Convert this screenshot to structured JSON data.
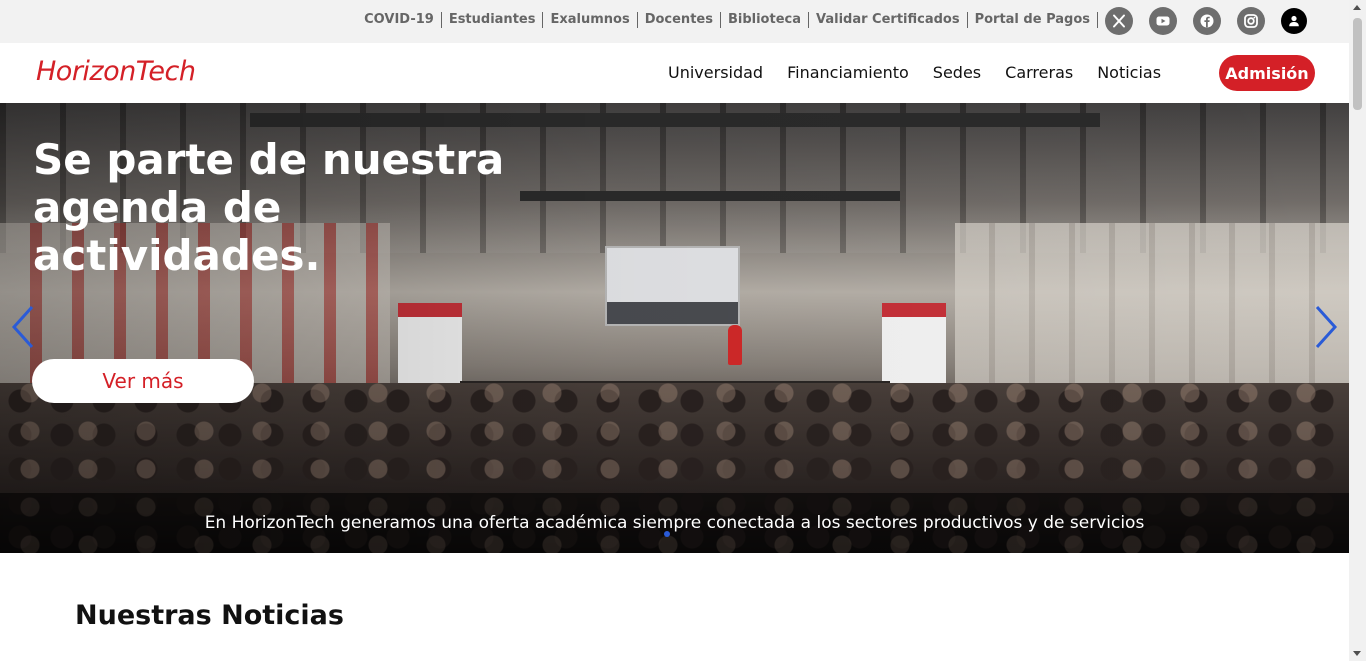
{
  "topbar": {
    "links": [
      "COVID-19",
      "Estudiantes",
      "Exalumnos",
      "Docentes",
      "Biblioteca",
      "Validar Certificados",
      "Portal de Pagos"
    ],
    "social_icons": [
      "x-twitter-icon",
      "youtube-icon",
      "facebook-icon",
      "instagram-icon"
    ],
    "user_icon": "user-icon"
  },
  "nav": {
    "logo": "HorizonTech",
    "links": [
      "Universidad",
      "Financiamiento",
      "Sedes",
      "Carreras",
      "Noticias"
    ],
    "cta": "Admisión"
  },
  "hero": {
    "title": "Se parte de nuestra agenda de actividades.",
    "button": "Ver más",
    "caption": "En HorizonTech generamos una oferta académica siempre conectada a los sectores productivos y de servicios",
    "prev_icon": "chevron-left-icon",
    "next_icon": "chevron-right-icon"
  },
  "news": {
    "title": "Nuestras Noticias"
  },
  "colors": {
    "brand": "#d42027",
    "arrows": "#2a5bd7",
    "topbar_bg": "#f2f2f2"
  }
}
